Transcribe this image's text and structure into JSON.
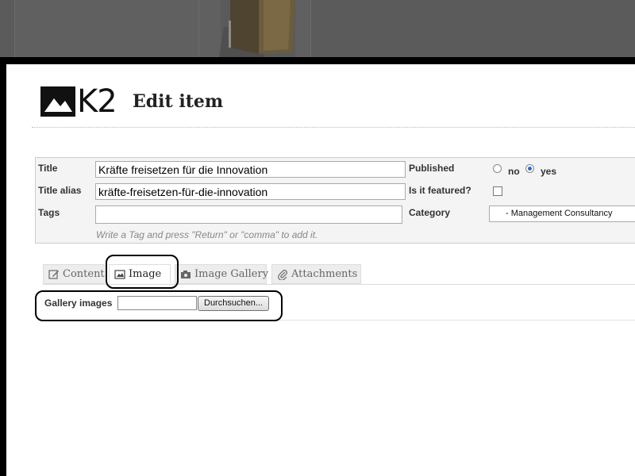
{
  "app": {
    "title": "Edit item",
    "logo_text": "K2"
  },
  "form": {
    "title_label": "Title",
    "title_value": "Kräfte freisetzen für die Innovation",
    "alias_label": "Title alias",
    "alias_value": "kräfte-freisetzen-für-die-innovation",
    "tags_label": "Tags",
    "tags_value": "",
    "tags_hint": "Write a Tag and press \"Return\" or \"comma\" to add it.",
    "published_label": "Published",
    "published_no": "no",
    "published_yes": "yes",
    "published_selected": "yes",
    "featured_label": "Is it featured?",
    "featured_checked": false,
    "category_label": "Category",
    "category_value": "- Management Consultancy"
  },
  "tabs": [
    {
      "label": "Content",
      "icon": "edit-icon",
      "active": false
    },
    {
      "label": "Image",
      "icon": "image-icon",
      "active": true
    },
    {
      "label": "Image Gallery",
      "icon": "camera-icon",
      "active": false
    },
    {
      "label": "Attachments",
      "icon": "paperclip-icon",
      "active": false
    }
  ],
  "gallery": {
    "label": "Gallery images",
    "browse_label": "Durchsuchen..."
  },
  "colors": {
    "radio_selected": "#2a6ad0",
    "topbar": "#5b5b5b",
    "page_border": "#000000"
  }
}
